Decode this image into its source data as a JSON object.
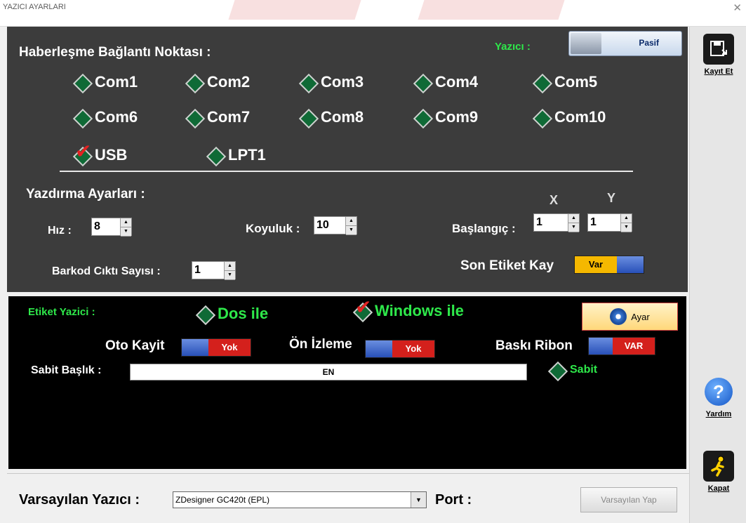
{
  "window": {
    "title": "YAZICI AYARLARI",
    "close_glyph": "✕"
  },
  "sidebar": {
    "save_label": "Kayıt Et",
    "help_label": "Yardım",
    "close_label": "Kapat",
    "help_glyph": "?"
  },
  "connection": {
    "title": "Haberleşme Bağlantı Noktası :",
    "ports_row1": [
      "Com1",
      "Com2",
      "Com3",
      "Com4",
      "Com5"
    ],
    "ports_row2": [
      "Com6",
      "Com7",
      "Com8",
      "Com9",
      "Com10"
    ],
    "usb_label": "USB",
    "lpt_label": "LPT1",
    "selected": "USB",
    "yazici_label": "Yazıcı :",
    "yazici_state": "Pasif"
  },
  "print_settings": {
    "title": "Yazdırma Ayarları :",
    "hiz_label": "Hız :",
    "hiz_value": "8",
    "koyuluk_label": "Koyuluk :",
    "koyuluk_value": "10",
    "x_label": "X",
    "y_label": "Y",
    "baslangic_label": "Başlangıç :",
    "baslangic_x": "1",
    "baslangic_y": "1",
    "barkod_label": "Barkod Cıktı Sayısı :",
    "barkod_value": "1",
    "son_etiket_label": "Son Etiket Kay",
    "son_etiket_state": "Var"
  },
  "label_printer": {
    "title": "Etiket Yazici :",
    "dos_label": "Dos ile",
    "windows_label": "Windows ile",
    "selected": "Windows ile",
    "ayar_label": "Ayar",
    "oto_kayit_label": "Oto Kayit",
    "oto_kayit_state": "Yok",
    "on_izleme_label": "Ön İzleme",
    "on_izleme_state": "Yok",
    "baski_ribon_label": "Baskı Ribon",
    "baski_ribon_state": "VAR",
    "sabit_baslik_label": "Sabit Başlık :",
    "sabit_baslik_value": "EN",
    "sabit_label": "Sabit"
  },
  "default_printer": {
    "label": "Varsayılan Yazıcı :",
    "value": "ZDesigner GC420t (EPL)",
    "arrow_glyph": "▼",
    "port_label": "Port :",
    "set_default_label": "Varsayılan Yap"
  },
  "colors": {
    "panel": "#3c3c3c",
    "accent_green": "#2ee84a",
    "toggle_red": "#d4201c",
    "toggle_gold": "#f5b800"
  }
}
